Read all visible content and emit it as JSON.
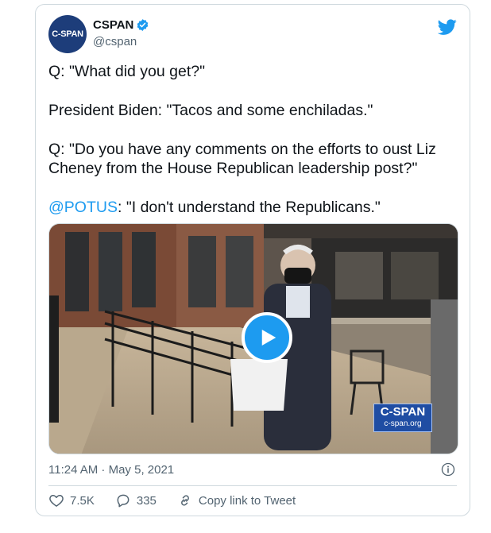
{
  "account": {
    "name": "CSPAN",
    "handle": "@cspan",
    "avatar_text": "C-SPAN"
  },
  "tweet": {
    "line1": "Q: \"What did you get?\"",
    "line2": "President Biden: \"Tacos and some enchiladas.\"",
    "line3": "Q: \"Do you have any comments on the efforts to oust Liz Cheney from the House Republican leadership post?\"",
    "mention": "@POTUS",
    "line4_rest": ": \"I don't understand the Republicans.\""
  },
  "media": {
    "watermark_title": "C-SPAN",
    "watermark_url": "c-span.org"
  },
  "timestamp": "11:24 AM · May 5, 2021",
  "actions": {
    "likes": "7.5K",
    "replies": "335",
    "copy_link": "Copy link to Tweet"
  },
  "colors": {
    "accent": "#1d9bf0",
    "text": "#0f1419",
    "secondary": "#536471",
    "avatar_bg": "#1d3d7a"
  }
}
